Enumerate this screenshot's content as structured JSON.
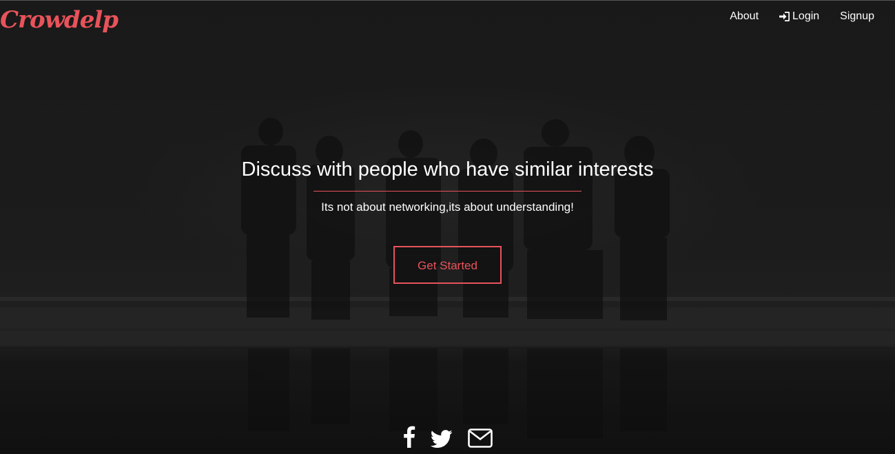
{
  "brand": {
    "name": "Crowdelp",
    "color": "#e8535a"
  },
  "nav": {
    "about_label": "About",
    "login_label": "Login",
    "login_icon": "sign-in-icon",
    "signup_label": "Signup"
  },
  "hero": {
    "headline": "Discuss with people who have similar interests",
    "subline": "Its not about networking,its about understanding!",
    "cta_label": "Get Started",
    "accent_color": "#e8535a"
  },
  "social": {
    "icons": [
      "facebook-icon",
      "twitter-icon",
      "envelope-icon"
    ]
  }
}
